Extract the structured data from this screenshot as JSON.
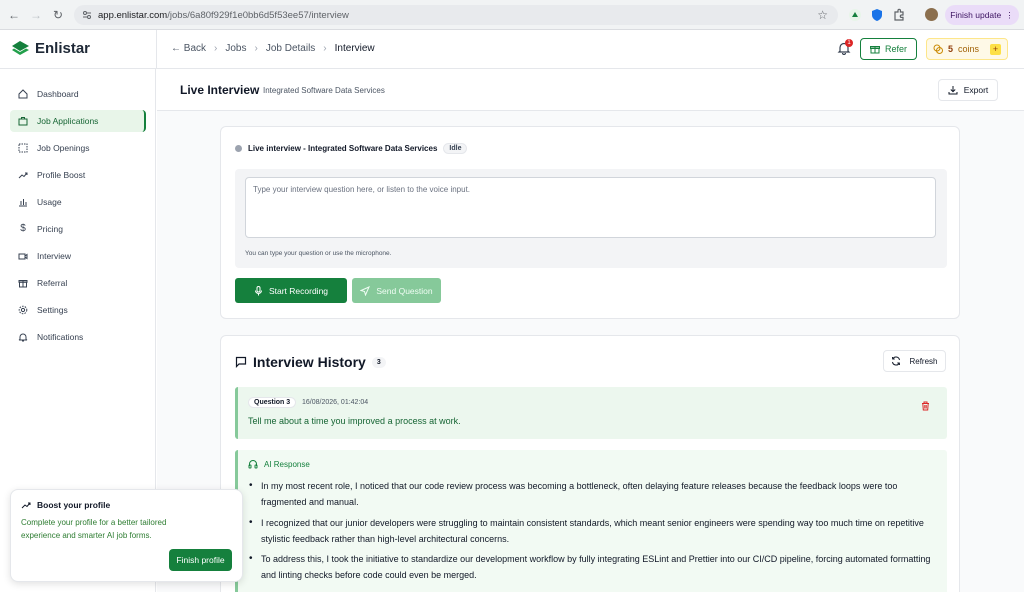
{
  "browser": {
    "url_host": "app.enlistar.com",
    "url_path": "/jobs/6a80f929f1e0bb6d5f53ee57/interview",
    "finish_update": "Finish update"
  },
  "header": {
    "logo": "Enlistar",
    "breadcrumb": {
      "back": "Back",
      "jobs": "Jobs",
      "job_details": "Job Details",
      "current": "Interview"
    },
    "notification_count": "1",
    "refer": "Refer",
    "coins_count": "5",
    "coins_label": "coins"
  },
  "sidebar": {
    "items": [
      {
        "label": "Dashboard",
        "icon": "home-icon"
      },
      {
        "label": "Job Applications",
        "icon": "briefcase-icon",
        "active": true
      },
      {
        "label": "Job Openings",
        "icon": "dashed-square-icon"
      },
      {
        "label": "Profile Boost",
        "icon": "trending-up-icon"
      },
      {
        "label": "Usage",
        "icon": "bar-chart-icon"
      },
      {
        "label": "Pricing",
        "icon": "dollar-icon"
      },
      {
        "label": "Interview",
        "icon": "video-icon"
      },
      {
        "label": "Referral",
        "icon": "gift-icon"
      },
      {
        "label": "Settings",
        "icon": "gear-icon"
      },
      {
        "label": "Notifications",
        "icon": "bell-icon"
      }
    ]
  },
  "boost": {
    "title": "Boost your profile",
    "text": "Complete your profile for a better tailored experience and smarter AI job forms.",
    "button": "Finish profile"
  },
  "page": {
    "title": "Live Interview",
    "subtitle": "Integrated Software Data Services",
    "export": "Export"
  },
  "live": {
    "session_title": "Live interview - Integrated Software Data Services",
    "status": "Idle",
    "placeholder": "Type your interview question here, or listen to the voice input.",
    "hint": "You can type your question or use the microphone.",
    "start_recording": "Start Recording",
    "send_question": "Send Question"
  },
  "history": {
    "title": "Interview History",
    "count": "3",
    "refresh": "Refresh",
    "question_label": "Question 3",
    "timestamp": "16/08/2026, 01:42:04",
    "question": "Tell me about a time you improved a process at work.",
    "ai_label": "AI Response",
    "answers": [
      "In my most recent role, I noticed that our code review process was becoming a bottleneck, often delaying feature releases because the feedback loops were too fragmented and manual.",
      "I recognized that our junior developers were struggling to maintain consistent standards, which meant senior engineers were spending way too much time on repetitive stylistic feedback rather than high-level architectural concerns.",
      "To address this, I took the initiative to standardize our development workflow by fully integrating ESLint and Prettier into our CI/CD pipeline, forcing automated formatting and linting checks before code could even be merged."
    ]
  },
  "colors": {
    "brand": "#15803d",
    "brand_light": "#86c99a",
    "active_bg": "#e8f5e9"
  }
}
